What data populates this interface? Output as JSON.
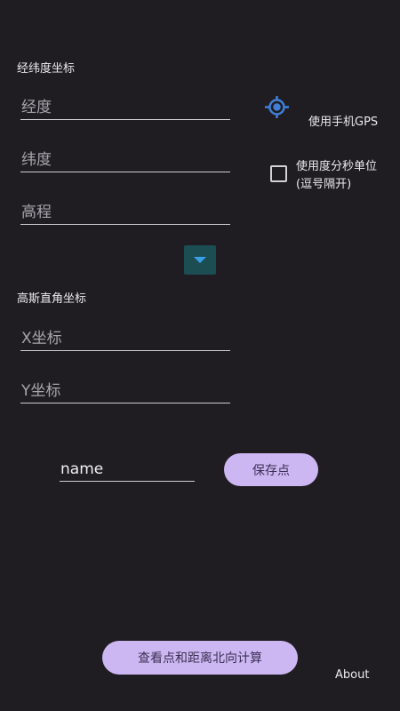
{
  "latlon": {
    "title": "经纬度坐标",
    "lon_placeholder": "经度",
    "lat_placeholder": "纬度",
    "alt_placeholder": "高程"
  },
  "gps": {
    "label": "使用手机GPS",
    "icon": "gps-locate-icon",
    "color": "#3f7fd6"
  },
  "dms": {
    "label_line1": "使用度分秒单位",
    "label_line2": "(逗号隔开)",
    "checked": false
  },
  "gauss": {
    "title": "高斯直角坐标",
    "x_placeholder": "X坐标",
    "y_placeholder": "Y坐标"
  },
  "save": {
    "name_value": "name",
    "button_label": "保存点"
  },
  "bottom": {
    "view_button_label": "查看点和距离北向计算",
    "about_label": "About"
  },
  "colors": {
    "background": "#1f1d22",
    "pill": "#cdb7f2",
    "dropdown": "#1c4d52",
    "dropdown_arrow": "#3aa0e6"
  }
}
